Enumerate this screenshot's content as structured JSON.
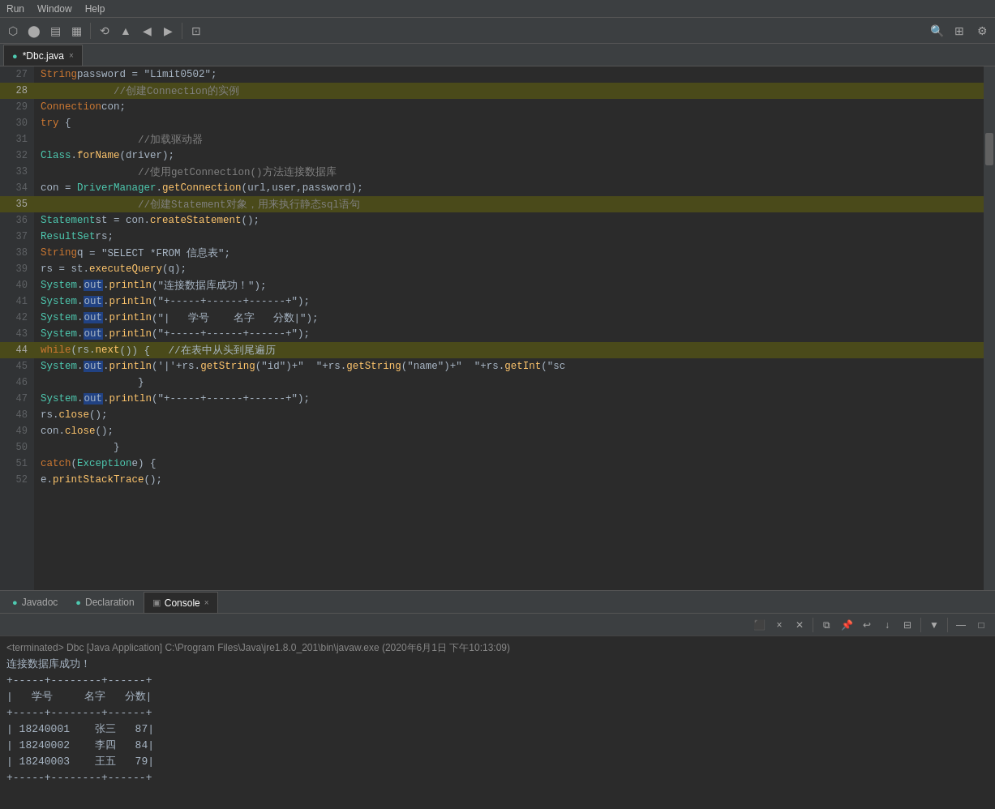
{
  "menu": {
    "items": [
      "Run",
      "Window",
      "Help"
    ]
  },
  "toolbar": {
    "buttons": [
      "▶",
      "⬛",
      "⏸",
      "⟳",
      "⬡",
      "⬢"
    ],
    "right_buttons": [
      "🔍",
      "⊞",
      "⊟"
    ]
  },
  "editor_tab": {
    "name": "*Dbc.java",
    "close": "×"
  },
  "code_lines": [
    {
      "num": 27,
      "content": "            String password = \"Limit0502\";",
      "highlight": false,
      "selected": false
    },
    {
      "num": 28,
      "content": "            //创建Connection的实例",
      "highlight": true,
      "selected": false
    },
    {
      "num": 29,
      "content": "            Connection con;",
      "highlight": false,
      "selected": false
    },
    {
      "num": 30,
      "content": "            try {",
      "highlight": false,
      "selected": false
    },
    {
      "num": 31,
      "content": "                //加载驱动器",
      "highlight": false,
      "selected": false
    },
    {
      "num": 32,
      "content": "                Class.forName(driver);",
      "highlight": false,
      "selected": false
    },
    {
      "num": 33,
      "content": "                //使用getConnection()方法连接数据库",
      "highlight": false,
      "selected": false
    },
    {
      "num": 34,
      "content": "                con = DriverManager.getConnection(url,user,password);",
      "highlight": false,
      "selected": false
    },
    {
      "num": 35,
      "content": "                //创建Statement对象，用来执行静态sql语句",
      "highlight": true,
      "selected": false
    },
    {
      "num": 36,
      "content": "                Statement st = con.createStatement();",
      "highlight": false,
      "selected": false
    },
    {
      "num": 37,
      "content": "                ResultSet rs;",
      "highlight": false,
      "selected": false
    },
    {
      "num": 38,
      "content": "                String q = \"SELECT *FROM 信息表\";",
      "highlight": false,
      "selected": false
    },
    {
      "num": 39,
      "content": "                rs = st.executeQuery(q);",
      "highlight": false,
      "selected": false
    },
    {
      "num": 40,
      "content": "                System.out.println(\"连接数据库成功！\");",
      "highlight": false,
      "selected": false
    },
    {
      "num": 41,
      "content": "                System.out.println(\"+-----+------+------+\");",
      "highlight": false,
      "selected": false
    },
    {
      "num": 42,
      "content": "                System.out.println(\"|   学号    名字   分数|\");",
      "highlight": false,
      "selected": false
    },
    {
      "num": 43,
      "content": "                System.out.println(\"+-----+------+------+\");",
      "highlight": false,
      "selected": false
    },
    {
      "num": 44,
      "content": "                while(rs.next()) {   //在表中从头到尾遍历",
      "highlight": true,
      "selected": false
    },
    {
      "num": 45,
      "content": "                    System.out.println('|'+rs.getString(\"id\")+\"  \"+rs.getString(\"name\")+\"  \"+rs.getInt(\"sc",
      "highlight": false,
      "selected": false
    },
    {
      "num": 46,
      "content": "                }",
      "highlight": false,
      "selected": false
    },
    {
      "num": 47,
      "content": "                System.out.println(\"+-----+------+------+\");",
      "highlight": false,
      "selected": false
    },
    {
      "num": 48,
      "content": "                rs.close();",
      "highlight": false,
      "selected": false
    },
    {
      "num": 49,
      "content": "                con.close();",
      "highlight": false,
      "selected": false
    },
    {
      "num": 50,
      "content": "            }",
      "highlight": false,
      "selected": false
    },
    {
      "num": 51,
      "content": "            catch(Exception e) {",
      "highlight": false,
      "selected": false
    },
    {
      "num": 52,
      "content": "                e.printStackTrace();",
      "highlight": false,
      "selected": false
    }
  ],
  "bottom_tabs": [
    {
      "id": "javadoc",
      "label": "Javadoc",
      "active": false,
      "closeable": false,
      "icon": "doc"
    },
    {
      "id": "declaration",
      "label": "Declaration",
      "active": false,
      "closeable": false,
      "icon": "decl"
    },
    {
      "id": "console",
      "label": "Console",
      "active": true,
      "closeable": true,
      "icon": "console"
    }
  ],
  "console": {
    "header": "<terminated> Dbc [Java Application] C:\\Program Files\\Java\\jre1.8.0_201\\bin\\javaw.exe (2020年6月1日 下午10:13:09)",
    "lines": [
      "连接数据库成功！",
      "+-----+--------+------+",
      "|   学号     名字   分数|",
      "+-----+--------+------+",
      "| 18240001    张三   87|",
      "| 18240002    李四   84|",
      "| 18240003    王五   79|",
      "+-----+--------+------+"
    ]
  }
}
